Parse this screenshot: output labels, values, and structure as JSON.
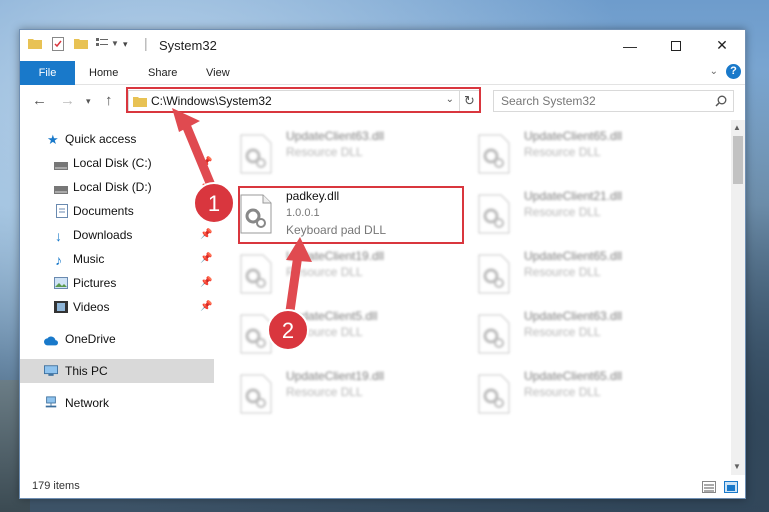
{
  "window": {
    "title": "System32"
  },
  "ribbon": {
    "tabs": [
      "File",
      "Home",
      "Share",
      "View"
    ]
  },
  "address_bar": {
    "path": "C:\\Windows\\System32"
  },
  "search": {
    "placeholder": "Search System32"
  },
  "sidebar": {
    "items": [
      {
        "label": "Quick access",
        "icon": "star-icon",
        "pinned": false
      },
      {
        "label": "Local Disk (C:)",
        "icon": "drive-icon",
        "pinned": true
      },
      {
        "label": "Local Disk (D:)",
        "icon": "drive-icon",
        "pinned": true
      },
      {
        "label": "Documents",
        "icon": "documents-icon",
        "pinned": true
      },
      {
        "label": "Downloads",
        "icon": "download-icon",
        "pinned": true
      },
      {
        "label": "Music",
        "icon": "music-icon",
        "pinned": true
      },
      {
        "label": "Pictures",
        "icon": "pictures-icon",
        "pinned": true
      },
      {
        "label": "Videos",
        "icon": "videos-icon",
        "pinned": true
      },
      {
        "label": "OneDrive",
        "icon": "cloud-icon",
        "pinned": false
      },
      {
        "label": "This PC",
        "icon": "computer-icon",
        "pinned": false,
        "selected": true
      },
      {
        "label": "Network",
        "icon": "network-icon",
        "pinned": false
      }
    ]
  },
  "files": [
    {
      "name": "UpdateClient63.dll",
      "description": "Resource DLL",
      "blurred": true
    },
    {
      "name": "UpdateClient65.dll",
      "description": "Resource DLL",
      "blurred": true
    },
    {
      "name": "padkey.dll",
      "version": "1.0.0.1",
      "description": "Keyboard pad DLL",
      "blurred": false
    },
    {
      "name": "UpdateClient21.dll",
      "description": "Resource DLL",
      "blurred": true
    },
    {
      "name": "UpdateClient19.dll",
      "description": "Resource DLL",
      "blurred": true
    },
    {
      "name": "UpdateClient65.dll",
      "description": "Resource DLL",
      "blurred": true
    },
    {
      "name": "UpdateClient5.dll",
      "description": "Resource DLL",
      "blurred": true
    },
    {
      "name": "UpdateClient63.dll",
      "description": "Resource DLL",
      "blurred": true
    },
    {
      "name": "UpdateClient19.dll",
      "description": "Resource DLL",
      "blurred": true
    },
    {
      "name": "UpdateClient65.dll",
      "description": "Resource DLL",
      "blurred": true
    }
  ],
  "status": {
    "item_count": "179 items"
  },
  "annotations": {
    "step1": "1",
    "step2": "2"
  },
  "colors": {
    "accent": "#1979ca",
    "highlight": "#d9363e",
    "selected_bg": "#d9d9d9"
  }
}
